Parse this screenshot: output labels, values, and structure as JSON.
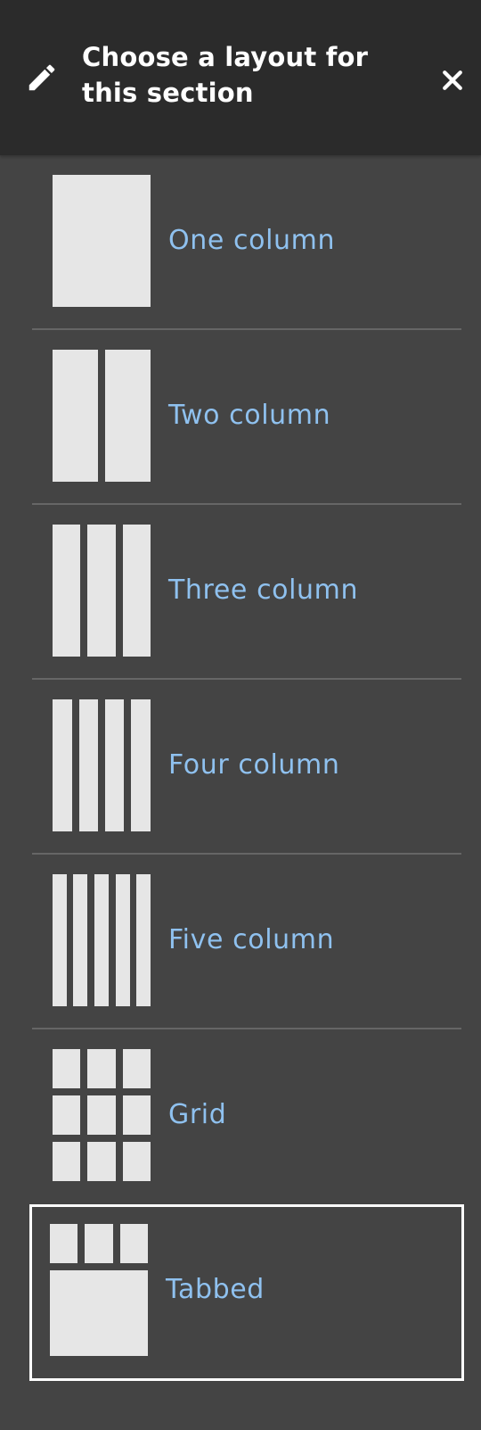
{
  "header": {
    "title": "Choose a layout for this section",
    "edit_icon": "pencil-icon",
    "close_icon": "close-icon"
  },
  "layouts": [
    {
      "label": "One column",
      "icon": "one-column-layout-icon"
    },
    {
      "label": "Two column",
      "icon": "two-column-layout-icon"
    },
    {
      "label": "Three column",
      "icon": "three-column-layout-icon"
    },
    {
      "label": "Four column",
      "icon": "four-column-layout-icon"
    },
    {
      "label": "Five column",
      "icon": "five-column-layout-icon"
    },
    {
      "label": "Grid",
      "icon": "grid-layout-icon"
    },
    {
      "label": "Tabbed",
      "icon": "tabbed-layout-icon",
      "selected": true
    }
  ],
  "colors": {
    "header_background": "#2b2b2b",
    "panel_background": "#444444",
    "link_text": "#8fc1ef",
    "thumbnail_fill": "#e6e6e6",
    "selected_border": "#ffffff"
  }
}
